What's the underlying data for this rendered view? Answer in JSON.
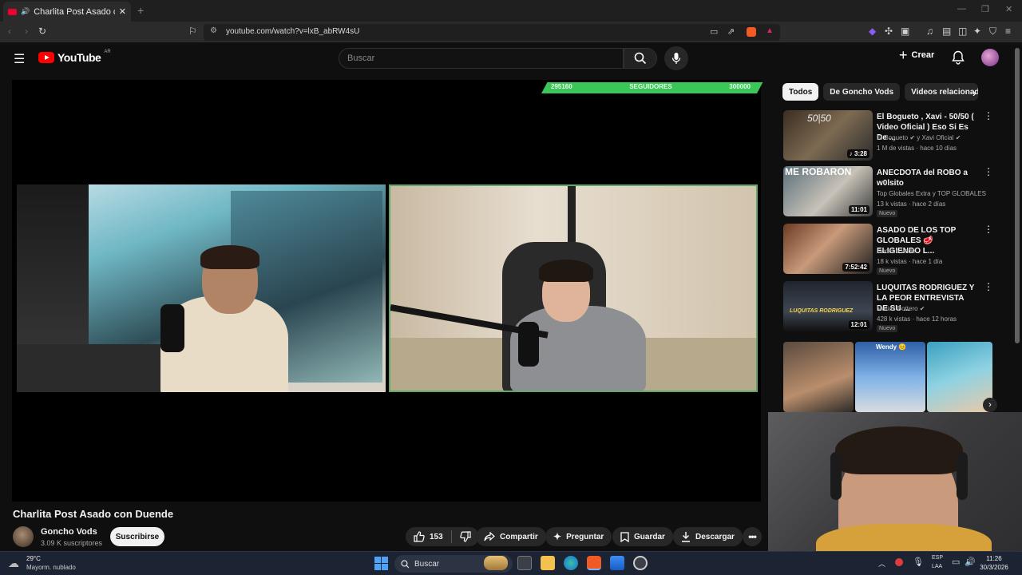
{
  "browser": {
    "tab_title": "Charlita Post Asado con Duende",
    "url": "youtube.com/watch?v=lxB_abRW4sU"
  },
  "youtube": {
    "logo_text": "YouTube",
    "country_code": "AR",
    "search_placeholder": "Buscar",
    "create_label": "Crear"
  },
  "overlay": {
    "followers_current": "295160",
    "followers_label": "SEGUIDORES",
    "followers_goal": "300000",
    "progress_fraction": 0.984
  },
  "video": {
    "title": "Charlita Post Asado con Duende",
    "channel": "Goncho Vods",
    "subscribers": "3.09 K suscriptores",
    "subscribe_label": "Suscribirse",
    "likes": "153",
    "share_label": "Compartir",
    "ask_label": "Preguntar",
    "save_label": "Guardar",
    "download_label": "Descargar"
  },
  "sidebar": {
    "chips": [
      "Todos",
      "De Goncho Vods",
      "Videos relacionado"
    ],
    "recommendations": [
      {
        "title": "El Bogueto , Xavi - 50/50 ( Video Oficial ) Eso Si Es De ...",
        "channel": "El Bogueto ✔ y Xavi Oficial ✔",
        "meta": "1 M de vistas · hace 10 días",
        "duration": "♪ 3:28",
        "badge": ""
      },
      {
        "title": "ANECDOTA del ROBO a w0lsito",
        "channel": "Top Globales Extra y TOP GLOBALES",
        "meta": "13 k vistas · hace 2 días",
        "duration": "11:01",
        "badge": "Nuevo"
      },
      {
        "title": "ASADO DE LOS TOP GLOBALES 🥩 ELIGIENDO L...",
        "channel": "Goncho Vods",
        "meta": "18 k vistas · hace 1 día",
        "duration": "7:52:42",
        "badge": "Nuevo"
      },
      {
        "title": "LUQUITAS RODRIGUEZ Y LA PEOR ENTREVISTA DE SU ...",
        "channel": "Matias Bottero ✔",
        "meta": "428 k vistas · hace 12 horas",
        "duration": "12:01",
        "badge": "Nuevo"
      }
    ],
    "shorts_label": "Wendy 😊"
  },
  "taskbar": {
    "temperature": "29°C",
    "weather": "Mayorm. nublado",
    "search_label": "Buscar",
    "lang_line1": "ESP",
    "lang_line2": "LAA",
    "time": "11:26",
    "date": "30/3/2026"
  },
  "colors": {
    "youtube_red": "#ff0000",
    "followers_green": "#3bc65a",
    "background": "#0f0f0f"
  }
}
